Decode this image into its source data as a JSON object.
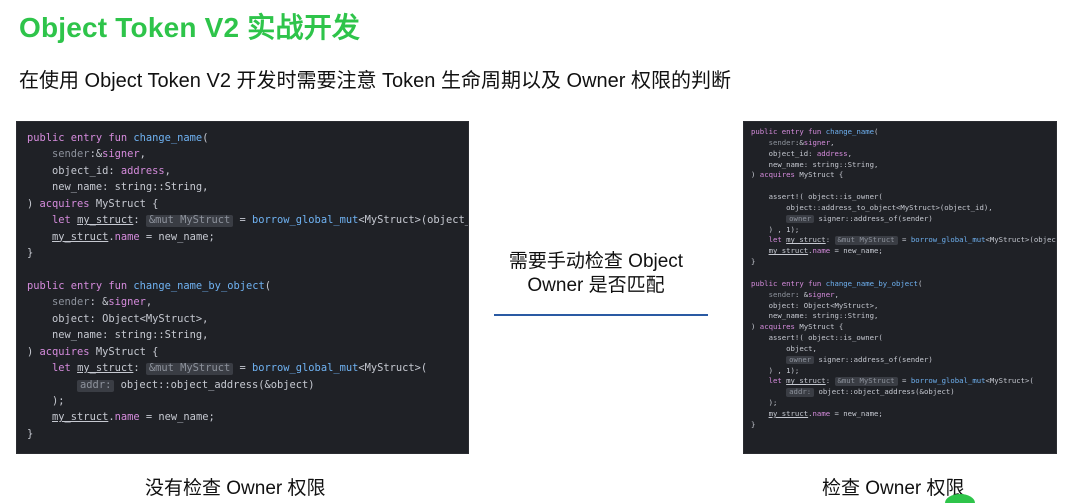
{
  "slide": {
    "title": "Object Token V2  实战开发",
    "subtitle": "在使用 Object Token V2 开发时需要注意 Token 生命周期以及 Owner 权限的判断",
    "middle_line1": "需要手动检查 Object",
    "middle_line2": "Owner 是否匹配",
    "left_caption": "没有检查 Owner 权限",
    "right_caption": "检查 Owner 权限"
  },
  "colors": {
    "title_green": "#2ec44a",
    "code_background": "#1f2126",
    "arrow_blue": "#2a5aa3"
  },
  "left_code": [
    [
      [
        "kw",
        "public entry fun "
      ],
      [
        "fn",
        "change_name"
      ],
      [
        "",
        "("
      ]
    ],
    [
      [
        "",
        "    "
      ],
      [
        "mu",
        "sender"
      ],
      [
        "",
        ":&"
      ],
      [
        "kw",
        "signer"
      ],
      [
        "",
        ","
      ]
    ],
    [
      [
        "",
        "    object_id: "
      ],
      [
        "kw",
        "address"
      ],
      [
        "",
        ","
      ]
    ],
    [
      [
        "",
        "    new_name: string::String,"
      ]
    ],
    [
      [
        "",
        ") "
      ],
      [
        "kw",
        "acquires "
      ],
      [
        "",
        "MyStruct {"
      ]
    ],
    [
      [
        "",
        "    "
      ],
      [
        "kw",
        "let "
      ],
      [
        "ul",
        "my_struct"
      ],
      [
        "",
        ": "
      ],
      [
        "hint",
        "&mut MyStruct"
      ],
      [
        "",
        " = "
      ],
      [
        "fn",
        "borrow_global_mut"
      ],
      [
        "",
        "<MyStruct>(object_id);"
      ]
    ],
    [
      [
        "",
        "    "
      ],
      [
        "ul",
        "my_struct"
      ],
      [
        "",
        "."
      ],
      [
        "kw",
        "name"
      ],
      [
        "",
        " = new_name;"
      ]
    ],
    [
      [
        "",
        "}"
      ]
    ],
    [
      [
        "",
        ""
      ]
    ],
    [
      [
        "kw",
        "public entry fun "
      ],
      [
        "fn",
        "change_name_by_object"
      ],
      [
        "",
        "("
      ]
    ],
    [
      [
        "",
        "    "
      ],
      [
        "mu",
        "sender"
      ],
      [
        "",
        ": &"
      ],
      [
        "kw",
        "signer"
      ],
      [
        "",
        ","
      ]
    ],
    [
      [
        "",
        "    object: Object<MyStruct>,"
      ]
    ],
    [
      [
        "",
        "    new_name: string::String,"
      ]
    ],
    [
      [
        "",
        ") "
      ],
      [
        "kw",
        "acquires "
      ],
      [
        "",
        "MyStruct {"
      ]
    ],
    [
      [
        "",
        "    "
      ],
      [
        "kw",
        "let "
      ],
      [
        "ul",
        "my_struct"
      ],
      [
        "",
        ": "
      ],
      [
        "hint",
        "&mut MyStruct"
      ],
      [
        "",
        " = "
      ],
      [
        "fn",
        "borrow_global_mut"
      ],
      [
        "",
        "<MyStruct>("
      ]
    ],
    [
      [
        "",
        "        "
      ],
      [
        "hint",
        "addr:"
      ],
      [
        "",
        " object::object_address(&object)"
      ]
    ],
    [
      [
        "",
        "    );"
      ]
    ],
    [
      [
        "",
        "    "
      ],
      [
        "ul",
        "my_struct"
      ],
      [
        "",
        "."
      ],
      [
        "kw",
        "name"
      ],
      [
        "",
        " = new_name;"
      ]
    ],
    [
      [
        "",
        "}"
      ]
    ]
  ],
  "right_code": [
    [
      [
        "kw",
        "public entry fun "
      ],
      [
        "fn",
        "change_name"
      ],
      [
        "",
        "("
      ]
    ],
    [
      [
        "",
        "    "
      ],
      [
        "mu",
        "sender"
      ],
      [
        "",
        ":&"
      ],
      [
        "kw",
        "signer"
      ],
      [
        "",
        ","
      ]
    ],
    [
      [
        "",
        "    object_id: "
      ],
      [
        "kw",
        "address"
      ],
      [
        "",
        ","
      ]
    ],
    [
      [
        "",
        "    new_name: string::String,"
      ]
    ],
    [
      [
        "",
        ") "
      ],
      [
        "kw",
        "acquires "
      ],
      [
        "",
        "MyStruct {"
      ]
    ],
    [
      [
        "",
        ""
      ]
    ],
    [
      [
        "",
        "    assert!( object::is_owner("
      ]
    ],
    [
      [
        "",
        "        object::address_to_object<MyStruct>(object_id),"
      ]
    ],
    [
      [
        "",
        "        "
      ],
      [
        "hint",
        "owner"
      ],
      [
        "",
        " signer::address_of(sender)"
      ]
    ],
    [
      [
        "",
        "    ) , 1);"
      ]
    ],
    [
      [
        "",
        "    "
      ],
      [
        "kw",
        "let "
      ],
      [
        "ul",
        "my_struct"
      ],
      [
        "",
        ": "
      ],
      [
        "hint",
        "&mut MyStruct"
      ],
      [
        "",
        " = "
      ],
      [
        "fn",
        "borrow_global_mut"
      ],
      [
        "",
        "<MyStruct>(object_id);"
      ]
    ],
    [
      [
        "",
        "    "
      ],
      [
        "ul",
        "my_struct"
      ],
      [
        "",
        "."
      ],
      [
        "kw",
        "name"
      ],
      [
        "",
        " = new_name;"
      ]
    ],
    [
      [
        "",
        "}"
      ]
    ],
    [
      [
        "",
        ""
      ]
    ],
    [
      [
        "kw",
        "public entry fun "
      ],
      [
        "fn",
        "change_name_by_object"
      ],
      [
        "",
        "("
      ]
    ],
    [
      [
        "",
        "    "
      ],
      [
        "mu",
        "sender"
      ],
      [
        "",
        ": &"
      ],
      [
        "kw",
        "signer"
      ],
      [
        "",
        ","
      ]
    ],
    [
      [
        "",
        "    object: Object<MyStruct>,"
      ]
    ],
    [
      [
        "",
        "    new_name: string::String,"
      ]
    ],
    [
      [
        "",
        ") "
      ],
      [
        "kw",
        "acquires "
      ],
      [
        "",
        "MyStruct {"
      ]
    ],
    [
      [
        "",
        "    assert!( object::is_owner("
      ]
    ],
    [
      [
        "",
        "        object,"
      ]
    ],
    [
      [
        "",
        "        "
      ],
      [
        "hint",
        "owner"
      ],
      [
        "",
        " signer::address_of(sender)"
      ]
    ],
    [
      [
        "",
        "    ) , 1);"
      ]
    ],
    [
      [
        "",
        "    "
      ],
      [
        "kw",
        "let "
      ],
      [
        "ul",
        "my_struct"
      ],
      [
        "",
        ": "
      ],
      [
        "hint",
        "&mut MyStruct"
      ],
      [
        "",
        " = "
      ],
      [
        "fn",
        "borrow_global_mut"
      ],
      [
        "",
        "<MyStruct>("
      ]
    ],
    [
      [
        "",
        "        "
      ],
      [
        "hint",
        "addr:"
      ],
      [
        "",
        " object::object_address(&object)"
      ]
    ],
    [
      [
        "",
        "    );"
      ]
    ],
    [
      [
        "",
        "    "
      ],
      [
        "ul",
        "my_struct"
      ],
      [
        "",
        "."
      ],
      [
        "kw",
        "name"
      ],
      [
        "",
        " = new_name;"
      ]
    ],
    [
      [
        "",
        "}"
      ]
    ]
  ]
}
